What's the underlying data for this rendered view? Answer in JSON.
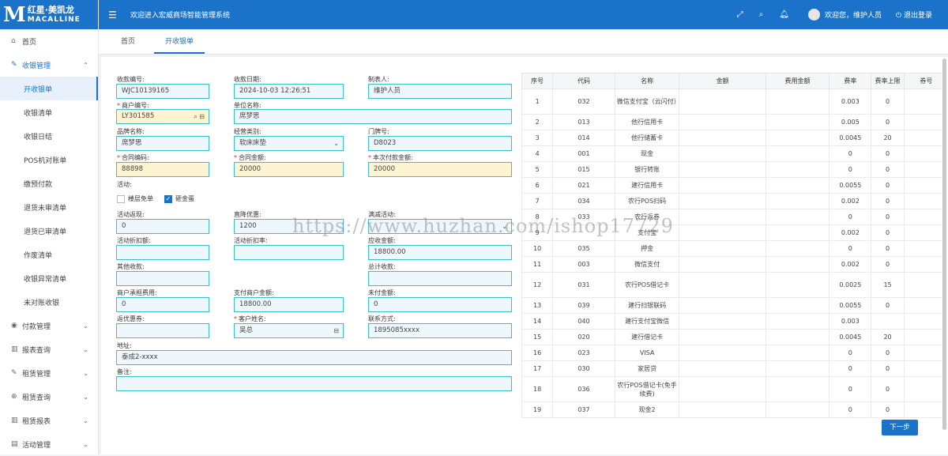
{
  "logo": {
    "letter": "M",
    "cn": "红星·美凯龙",
    "en": "MACALLINE"
  },
  "topbar": {
    "title": "欢迎进入宏威商场智能管理系统",
    "welcome": "欢迎您，维护人员",
    "logout": "退出登录"
  },
  "menu": [
    {
      "label": "首页",
      "icon": "home-icon"
    },
    {
      "label": "收银管理",
      "icon": "edit-icon",
      "open": true
    },
    {
      "label": "开收银单",
      "sub": true,
      "active": true
    },
    {
      "label": "收银清单",
      "sub": true
    },
    {
      "label": "收银日结",
      "sub": true
    },
    {
      "label": "POS机对账单",
      "sub": true
    },
    {
      "label": "缴预付款",
      "sub": true
    },
    {
      "label": "退货未审清单",
      "sub": true
    },
    {
      "label": "退货已审清单",
      "sub": true
    },
    {
      "label": "作废清单",
      "sub": true
    },
    {
      "label": "收银异常清单",
      "sub": true
    },
    {
      "label": "未对账收银",
      "sub": true
    },
    {
      "label": "付款管理",
      "icon": "payment-icon"
    },
    {
      "label": "报表查询",
      "icon": "chart-icon"
    },
    {
      "label": "租赁管理",
      "icon": "edit-icon"
    },
    {
      "label": "租赁查询",
      "icon": "search-icon"
    },
    {
      "label": "租赁报表",
      "icon": "chart-icon"
    },
    {
      "label": "活动管理",
      "icon": "calendar-icon"
    }
  ],
  "tabs": [
    "首页",
    "开收银单"
  ],
  "form": {
    "receipt_no": {
      "label": "收款编号:",
      "value": "WJC10139165"
    },
    "receipt_date": {
      "label": "收款日期:",
      "value": "2024-10-03 12:26:51"
    },
    "maker": {
      "label": "制表人:",
      "value": "维护人员"
    },
    "merchant_no": {
      "label": "商户编号:",
      "value": "LY301585"
    },
    "unit_name": {
      "label": "单位名称:",
      "value": "席梦思"
    },
    "brand": {
      "label": "品牌名称:",
      "value": "席梦思"
    },
    "category": {
      "label": "经营类别:",
      "value": "软床床垫"
    },
    "door_no": {
      "label": "门牌号:",
      "value": "D8023"
    },
    "contract_no": {
      "label": "合同编码:",
      "value": "88898"
    },
    "contract_amount": {
      "label": "合同金额:",
      "value": "20000"
    },
    "pay_amount": {
      "label": "本次付款金额:",
      "value": "20000"
    },
    "activity": {
      "label": "活动:"
    },
    "check1": {
      "label": "楼层免单",
      "checked": false
    },
    "check2": {
      "label": "砸金蛋",
      "checked": true
    },
    "act_return": {
      "label": "活动返现:",
      "value": "0"
    },
    "direct_discount": {
      "label": "直降优惠:",
      "value": "1200"
    },
    "full_reduce": {
      "label": "满减活动:",
      "value": ""
    },
    "act_discount_amt": {
      "label": "活动折扣额:",
      "value": ""
    },
    "act_discount_rate": {
      "label": "活动折扣率:",
      "value": ""
    },
    "receivable": {
      "label": "应收金额:",
      "value": "18800.00"
    },
    "other_income": {
      "label": "其他收款:",
      "value": ""
    },
    "total_income": {
      "label": "总计收款:",
      "value": ""
    },
    "merchant_fee": {
      "label": "商户承担费用:",
      "value": "0"
    },
    "paid_merchant": {
      "label": "支付商户金额:",
      "value": "18800.00"
    },
    "unpaid": {
      "label": "未付金额:",
      "value": "0"
    },
    "coupon": {
      "label": "返优惠券:",
      "value": ""
    },
    "customer": {
      "label": "客户姓名:",
      "value": "吴总"
    },
    "contact": {
      "label": "联系方式:",
      "value": "1895085xxxx"
    },
    "address": {
      "label": "地址:",
      "value": "泰成2-xxxx"
    },
    "remark": {
      "label": "备注:",
      "value": ""
    }
  },
  "table": {
    "headers": [
      "序号",
      "代码",
      "名称",
      "金额",
      "费用金额",
      "费率",
      "费率上限",
      "券号"
    ],
    "rows": [
      [
        "1",
        "032",
        "微信支付宝（云闪付）",
        "",
        "",
        "0.003",
        "0",
        ""
      ],
      [
        "2",
        "013",
        "他行信用卡",
        "",
        "",
        "0.005",
        "0",
        ""
      ],
      [
        "3",
        "014",
        "他行储蓄卡",
        "",
        "",
        "0.0045",
        "20",
        ""
      ],
      [
        "4",
        "001",
        "现金",
        "",
        "",
        "0",
        "0",
        ""
      ],
      [
        "5",
        "015",
        "银行转账",
        "",
        "",
        "0",
        "0",
        ""
      ],
      [
        "6",
        "021",
        "建行信用卡",
        "",
        "",
        "0.0055",
        "0",
        ""
      ],
      [
        "7",
        "034",
        "农行POS扫码",
        "",
        "",
        "0.002",
        "0",
        ""
      ],
      [
        "8",
        "033",
        "农行返券",
        "",
        "",
        "0",
        "0",
        ""
      ],
      [
        "9",
        "",
        "支付宝",
        "",
        "",
        "0.002",
        "0",
        ""
      ],
      [
        "10",
        "035",
        "押金",
        "",
        "",
        "0",
        "0",
        ""
      ],
      [
        "11",
        "003",
        "微信支付",
        "",
        "",
        "0.002",
        "0",
        ""
      ],
      [
        "12",
        "031",
        "农行POS借记卡",
        "",
        "",
        "0.0025",
        "15",
        ""
      ],
      [
        "13",
        "039",
        "建行扫银联码",
        "",
        "",
        "0.0055",
        "0",
        ""
      ],
      [
        "14",
        "040",
        "建行支付宝微信",
        "",
        "",
        "0.003",
        "",
        ""
      ],
      [
        "15",
        "020",
        "建行借记卡",
        "",
        "",
        "0.0045",
        "20",
        ""
      ],
      [
        "16",
        "023",
        "VISA",
        "",
        "",
        "0",
        "0",
        ""
      ],
      [
        "17",
        "030",
        "家居贷",
        "",
        "",
        "0",
        "0",
        ""
      ],
      [
        "18",
        "036",
        "农行POS借记卡(免手续费)",
        "",
        "",
        "0",
        "0",
        ""
      ],
      [
        "19",
        "037",
        "现金2",
        "",
        "",
        "0",
        "0",
        ""
      ]
    ]
  },
  "next_button": "下一步",
  "watermark": "https://www.huzhan.com/ishop17729"
}
